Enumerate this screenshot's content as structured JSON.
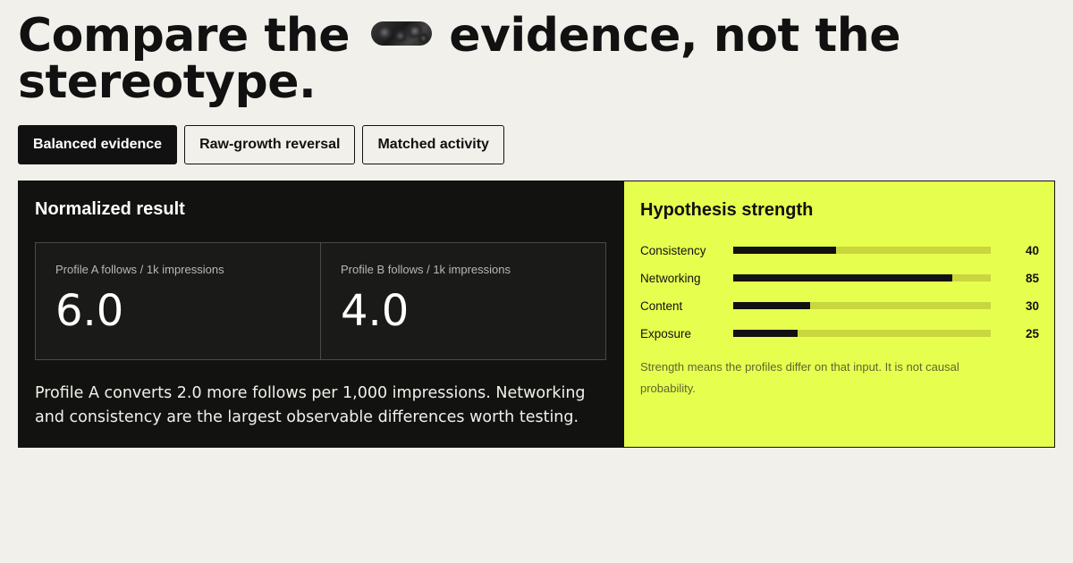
{
  "headline": {
    "before": "Compare the",
    "image": "abstract-texture-pill",
    "after": "evidence, not the stereotype."
  },
  "tabs": [
    {
      "label": "Balanced evidence",
      "active": true
    },
    {
      "label": "Raw-growth reversal",
      "active": false
    },
    {
      "label": "Matched activity",
      "active": false
    }
  ],
  "result": {
    "title": "Normalized result",
    "metrics": [
      {
        "label": "Profile A follows / 1k impressions",
        "value": "6.0"
      },
      {
        "label": "Profile B follows / 1k impressions",
        "value": "4.0"
      }
    ],
    "summary": "Profile A converts 2.0 more follows per 1,000 impressions. Networking and consistency are the largest observable differences worth testing."
  },
  "strength": {
    "title": "Hypothesis strength",
    "scale_max": 100,
    "bars": [
      {
        "label": "Consistency",
        "value": 40
      },
      {
        "label": "Networking",
        "value": 85
      },
      {
        "label": "Content",
        "value": 30
      },
      {
        "label": "Exposure",
        "value": 25
      }
    ],
    "note": "Strength means the profiles differ on that input. It is not causal probability."
  },
  "colors": {
    "background": "#f2f0ea",
    "dark": "#121210",
    "accent": "#e6ff4f",
    "track": "#c9d63e"
  }
}
